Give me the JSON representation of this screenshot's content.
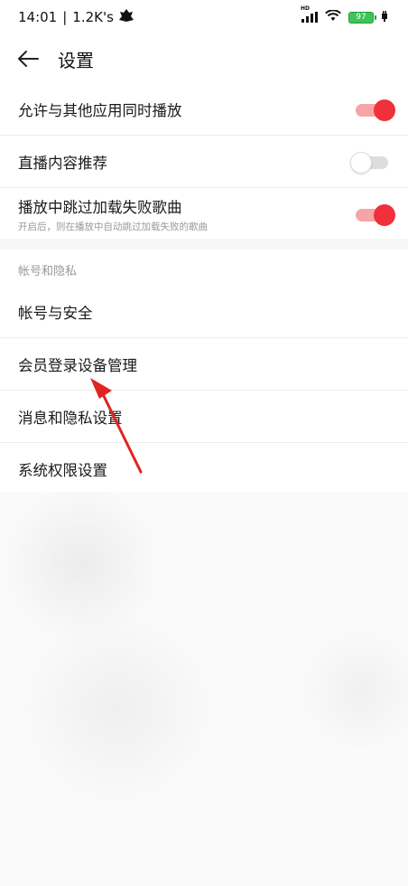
{
  "statusbar": {
    "time": "14:01",
    "separator": "|",
    "speed": "1.2K's",
    "battery": "97",
    "network": "HD"
  },
  "header": {
    "title": "设置"
  },
  "playback": {
    "rows": [
      {
        "label": "允许与其他应用同时播放",
        "sub": "",
        "toggle": "on"
      },
      {
        "label": "直播内容推荐",
        "sub": "",
        "toggle": "off"
      },
      {
        "label": "播放中跳过加载失败歌曲",
        "sub": "开启后，则在播放中自动跳过加载失败的歌曲",
        "toggle": "on"
      }
    ]
  },
  "account": {
    "section_title": "帐号和隐私",
    "items": [
      {
        "label": "帐号与安全"
      },
      {
        "label": "会员登录设备管理"
      },
      {
        "label": "消息和隐私设置"
      },
      {
        "label": "系统权限设置"
      }
    ]
  },
  "colors": {
    "toggle_on": "#f0303a",
    "toggle_track_on": "#f7a4a6",
    "annotation_arrow": "#e02424"
  }
}
